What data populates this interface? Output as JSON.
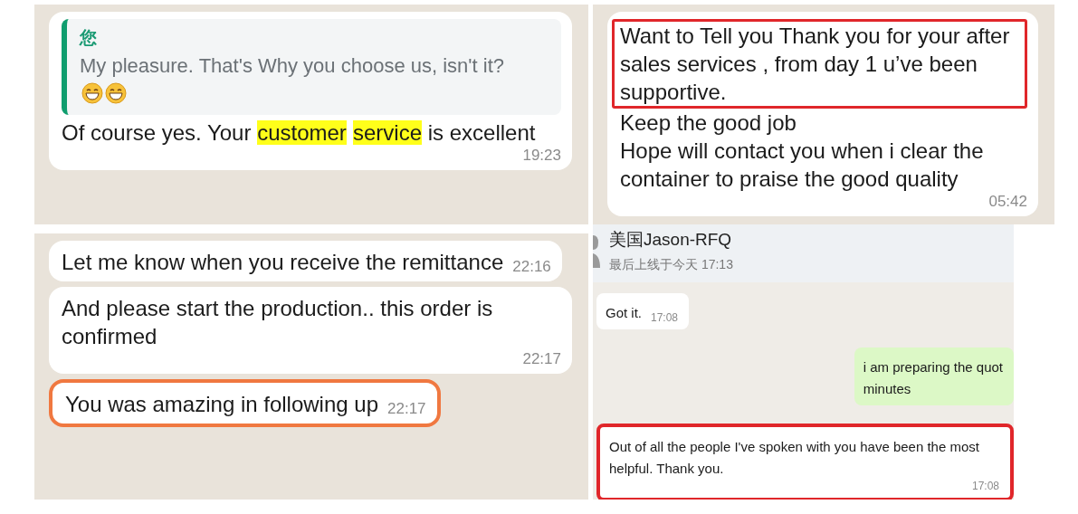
{
  "panels": [
    {
      "kind": "mobile",
      "messages": [
        {
          "kind": "incoming",
          "outlined": false,
          "quote": {
            "author": "您",
            "text": "My pleasure. That's Why you choose us, isn't it?"
          },
          "blocks": [
            {
              "outlined": false,
              "segments": [
                {
                  "text": "Of course yes. Your ",
                  "highlighted": false
                },
                {
                  "text": "customer",
                  "highlighted": true
                },
                {
                  "text": "service",
                  "highlighted": true
                },
                {
                  "text": " is excellent",
                  "highlighted": false
                }
              ]
            }
          ],
          "time": "19:23"
        }
      ]
    },
    {
      "kind": "mobile",
      "messages": [
        {
          "kind": "incoming",
          "outlined": false,
          "blocks": [
            {
              "outlined": true,
              "color": "#e0262a",
              "text": "Want to Tell you Thank you for your after sales services , from day 1 u’ve been supportive."
            },
            {
              "outlined": false,
              "text": "Keep the good job"
            },
            {
              "outlined": false,
              "text": "Hope will contact you when i clear the container to praise the good quality"
            }
          ],
          "time": "05:42"
        }
      ]
    },
    {
      "kind": "mobile",
      "messages": [
        {
          "kind": "incoming",
          "outlined": false,
          "blocks": [
            {
              "outlined": false,
              "text": "Let me know when you receive the remittance"
            }
          ],
          "time": "22:16"
        },
        {
          "kind": "incoming",
          "outlined": false,
          "blocks": [
            {
              "outlined": false,
              "text": "And please start the production.. this order is confirmed"
            }
          ],
          "time": "22:17"
        },
        {
          "kind": "incoming",
          "outlined": true,
          "color": "#f07840",
          "blocks": [
            {
              "outlined": false,
              "text": "You was amazing in following up"
            }
          ],
          "time": "22:17"
        }
      ]
    },
    {
      "kind": "desktop",
      "header": {
        "title": "美国Jason-RFQ",
        "status": "最后上线于今天 17:13"
      },
      "messages": [
        {
          "kind": "incoming",
          "outlined": false,
          "blocks": [
            {
              "outlined": false,
              "text": "Got it."
            }
          ],
          "time": "17:08"
        },
        {
          "kind": "outgoing",
          "outlined": false,
          "blocks": [
            {
              "outlined": false,
              "text": "i am preparing the quot"
            },
            {
              "outlined": false,
              "text": "minutes"
            }
          ]
        },
        {
          "kind": "incoming",
          "outlined": true,
          "color": "#e0262a",
          "blocks": [
            {
              "outlined": false,
              "text": "Out of all the people I've spoken with you have been the most helpful.  Thank you."
            }
          ],
          "time": "17:08"
        }
      ]
    }
  ]
}
